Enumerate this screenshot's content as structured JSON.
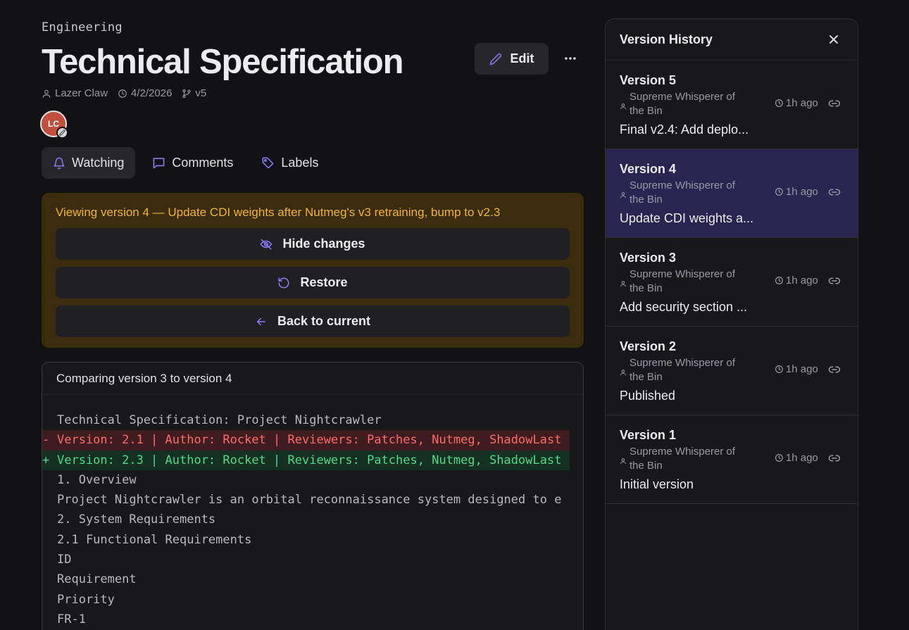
{
  "breadcrumb": "Engineering",
  "title": "Technical Specification",
  "actions": {
    "edit_label": "Edit"
  },
  "meta": {
    "author": "Lazer Claw",
    "date": "4/2/2026",
    "version": "v5"
  },
  "avatar": {
    "initials": "LC",
    "color": "#c0503d"
  },
  "tabs": [
    {
      "label": "Watching",
      "icon": "bell-icon"
    },
    {
      "label": "Comments",
      "icon": "comment-icon"
    },
    {
      "label": "Labels",
      "icon": "tag-icon"
    }
  ],
  "banner": {
    "text": "Viewing version 4 — Update CDI weights after Nutmeg's v3 retraining, bump to v2.3",
    "hide_changes": "Hide changes",
    "restore": "Restore",
    "back_to_current": "Back to current"
  },
  "diff": {
    "header": "Comparing version 3 to version 4",
    "lines": [
      {
        "type": "same",
        "text": "Technical Specification: Project Nightcrawler"
      },
      {
        "type": "removed",
        "text": "Version: 2.1 | Author: Rocket | Reviewers: Patches, Nutmeg, ShadowLast"
      },
      {
        "type": "added",
        "text": "Version: 2.3 | Author: Rocket | Reviewers: Patches, Nutmeg, ShadowLast"
      },
      {
        "type": "same",
        "text": "1. Overview"
      },
      {
        "type": "same",
        "text": "Project Nightcrawler is an orbital reconnaissance system designed to e"
      },
      {
        "type": "same",
        "text": "2. System Requirements"
      },
      {
        "type": "same",
        "text": "2.1 Functional Requirements"
      },
      {
        "type": "same",
        "text": "ID"
      },
      {
        "type": "same",
        "text": "Requirement"
      },
      {
        "type": "same",
        "text": "Priority"
      },
      {
        "type": "same",
        "text": "FR-1"
      }
    ]
  },
  "history": {
    "title": "Version History",
    "versions": [
      {
        "title": "Version 5",
        "author": "Supreme Whisperer of the Bin",
        "time": "1h ago",
        "description": "Final v2.4: Add deplo..."
      },
      {
        "title": "Version 4",
        "author": "Supreme Whisperer of the Bin",
        "time": "1h ago",
        "description": "Update CDI weights a..."
      },
      {
        "title": "Version 3",
        "author": "Supreme Whisperer of the Bin",
        "time": "1h ago",
        "description": "Add security section ..."
      },
      {
        "title": "Version 2",
        "author": "Supreme Whisperer of the Bin",
        "time": "1h ago",
        "description": "Published"
      },
      {
        "title": "Version 1",
        "author": "Supreme Whisperer of the Bin",
        "time": "1h ago",
        "description": "Initial version"
      }
    ]
  },
  "colors": {
    "accent": "#8b7cf6",
    "banner_bg": "#3a2c0c",
    "banner_text": "#f2b424",
    "removed": "#ff6b6b",
    "added": "#4fd98a",
    "selected_version_bg": "#2a2450"
  }
}
